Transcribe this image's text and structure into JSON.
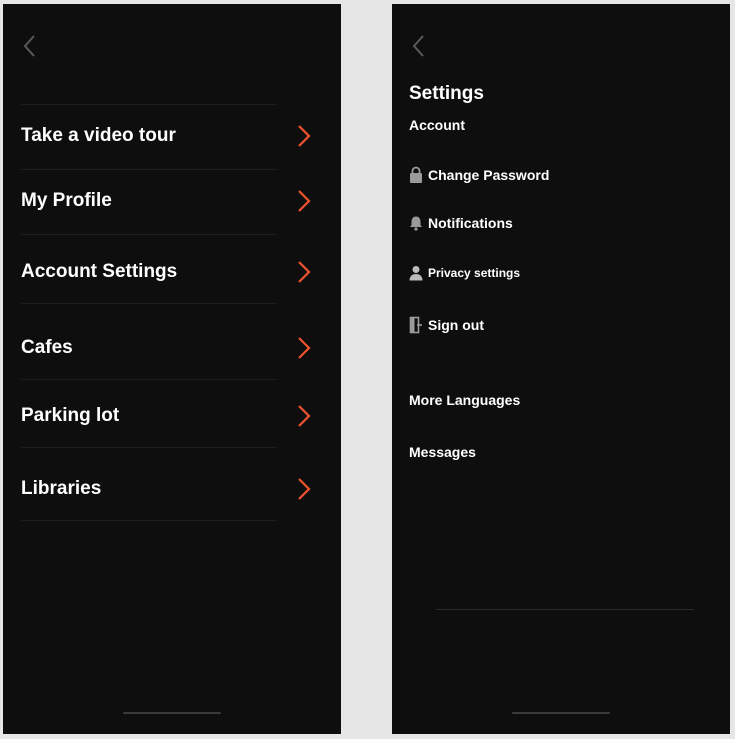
{
  "colors": {
    "background": "#0e0e0e",
    "accent_chevron": "#f0542c",
    "text": "#ffffff",
    "icon_gray": "#9a9a9a"
  },
  "left_screen": {
    "back_icon": "chevron-left-icon",
    "menu_items": [
      {
        "label": "Take a video tour",
        "icon": "chevron-right-icon"
      },
      {
        "label": "My Profile",
        "icon": "chevron-right-icon"
      },
      {
        "label": "Account Settings",
        "icon": "chevron-right-icon"
      },
      {
        "label": "Cafes",
        "icon": "chevron-right-icon"
      },
      {
        "label": "Parking lot",
        "icon": "chevron-right-icon"
      },
      {
        "label": "Libraries",
        "icon": "chevron-right-icon"
      }
    ]
  },
  "right_screen": {
    "back_icon": "chevron-left-icon",
    "title": "Settings",
    "account_section": {
      "label": "Account",
      "items": [
        {
          "label": "Change Password",
          "icon": "lock-icon"
        },
        {
          "label": "Notifications",
          "icon": "bell-icon"
        },
        {
          "label": "Privacy settings",
          "icon": "person-icon"
        },
        {
          "label": "Sign out",
          "icon": "sign-out-icon"
        }
      ]
    },
    "links": [
      {
        "label": "More Languages"
      },
      {
        "label": "Messages"
      }
    ]
  }
}
